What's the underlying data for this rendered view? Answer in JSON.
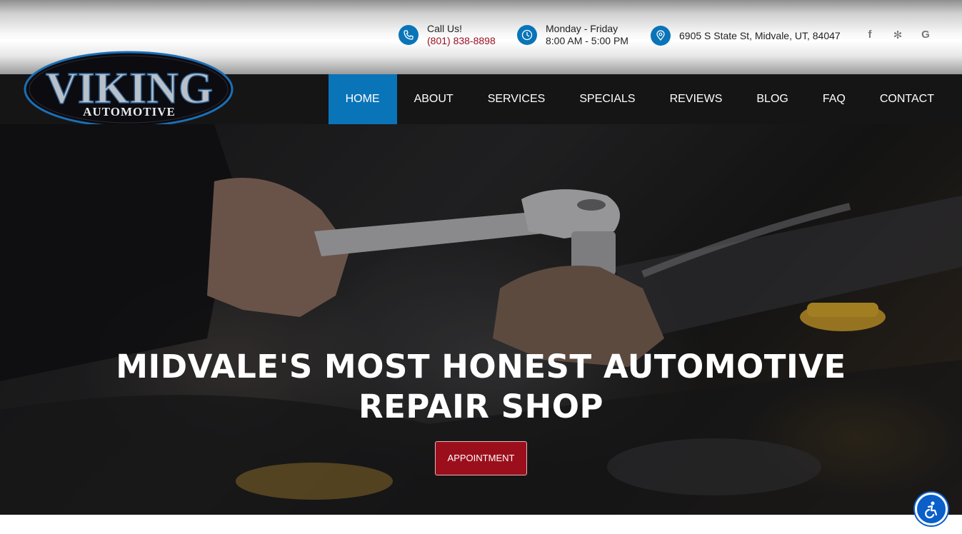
{
  "header": {
    "call": {
      "label": "Call Us!",
      "phone": "(801) 838-8898"
    },
    "hours": {
      "days": "Monday - Friday",
      "time": "8:00 AM - 5:00 PM"
    },
    "address": "6905 S State St, Midvale, UT, 84047",
    "social": [
      {
        "name": "facebook-icon",
        "glyph": "f"
      },
      {
        "name": "yelp-icon",
        "glyph": "✻"
      },
      {
        "name": "google-icon",
        "glyph": "G"
      }
    ]
  },
  "logo": {
    "line1": "VIKING",
    "line2": "AUTOMOTIVE"
  },
  "nav": [
    "HOME",
    "ABOUT",
    "SERVICES",
    "SPECIALS",
    "REVIEWS",
    "BLOG",
    "FAQ",
    "CONTACT"
  ],
  "hero": {
    "headline_line1": "MIDVALE'S MOST HONEST AUTOMOTIVE",
    "headline_line2": "REPAIR SHOP",
    "button": "APPOINTMENT"
  },
  "colors": {
    "accent": "#0a74b8",
    "brand_red": "#9b0f1c",
    "nav_bg": "#151515"
  }
}
